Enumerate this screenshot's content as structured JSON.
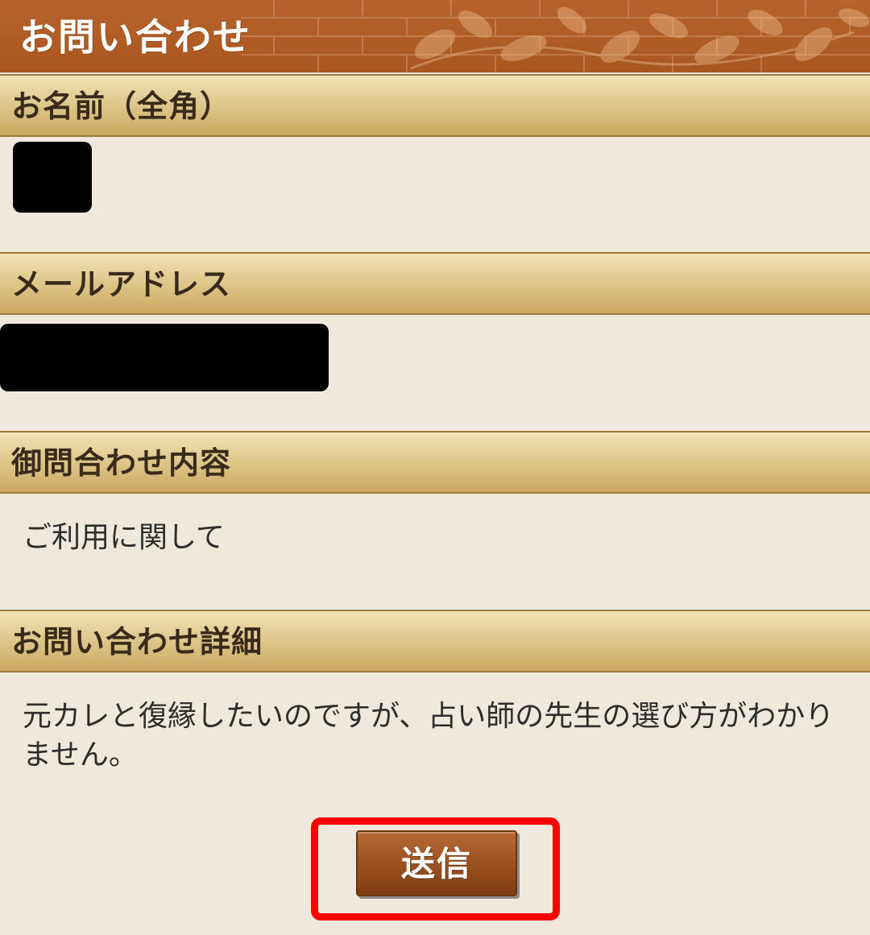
{
  "header": {
    "title": "お問い合わせ"
  },
  "sections": [
    {
      "label": "お名前（全角）",
      "value": ""
    },
    {
      "label": "メールアドレス",
      "value": ""
    },
    {
      "label": "御問合わせ内容",
      "value": "ご利用に関して"
    },
    {
      "label": "お問い合わせ詳細",
      "value": "元カレと復縁したいのですが、占い師の先生の選び方がわかりません。"
    }
  ],
  "submit": {
    "label": "送信"
  },
  "colors": {
    "header_bg": "#b05c25",
    "section_bar": "#dcc488",
    "page_bg": "#efe8dc",
    "button_bg": "#9a4f1f",
    "highlight": "#ff0000",
    "redaction": "#000000"
  }
}
